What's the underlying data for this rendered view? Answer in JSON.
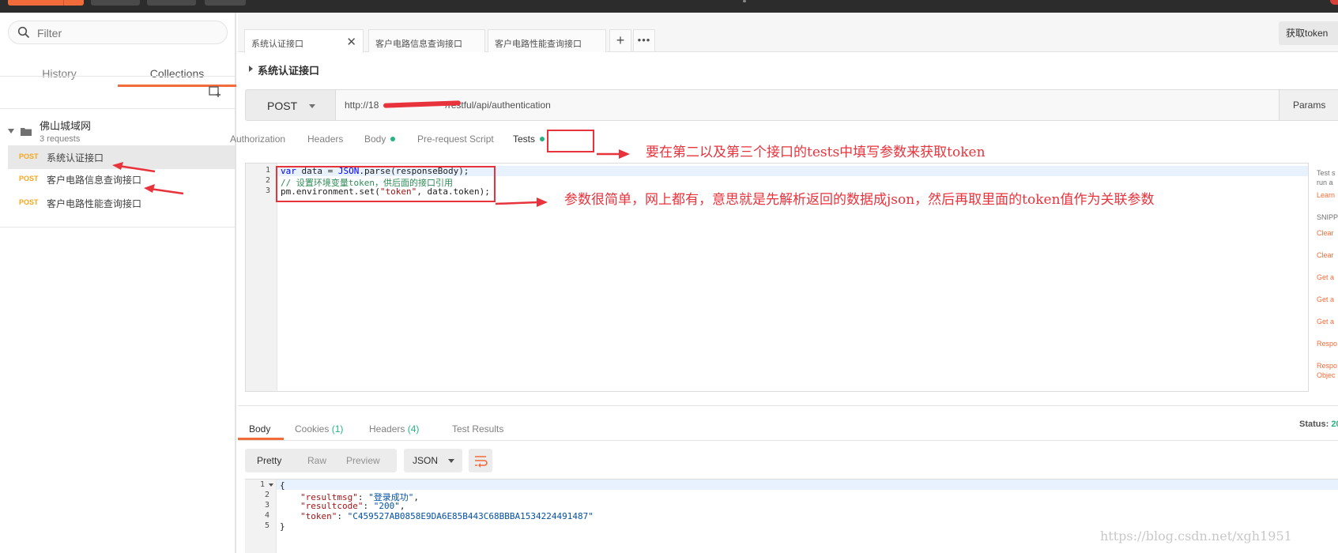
{
  "sidebar": {
    "filter_placeholder": "Filter",
    "tabs": {
      "history": "History",
      "collections": "Collections"
    },
    "collection": {
      "name": "佛山城域网",
      "count": "3 requests"
    },
    "requests": [
      {
        "method": "POST",
        "name": "系统认证接口"
      },
      {
        "method": "POST",
        "name": "客户电路信息查询接口"
      },
      {
        "method": "POST",
        "name": "客户电路性能查询接口"
      }
    ]
  },
  "tabs": {
    "items": [
      "系统认证接口",
      "客户电路信息查询接口",
      "客户电路性能查询接口"
    ],
    "add": "+",
    "more": "•••"
  },
  "get_token_label": "获取token",
  "request": {
    "title": "系统认证接口",
    "method": "POST",
    "url": "http://18",
    "url_suffix": "/restful/api/authentication",
    "params_label": "Params",
    "sub_tabs": {
      "authorization": "Authorization",
      "headers": "Headers",
      "body": "Body",
      "prerequest": "Pre-request Script",
      "tests": "Tests"
    }
  },
  "tests_code": {
    "line_numbers": [
      "1",
      "2",
      "3"
    ],
    "line1_a": "var",
    "line1_b": " data = ",
    "line1_c": "JSON",
    "line1_d": ".parse(responseBody);",
    "line2": "// 设置环境变量token，供后面的接口引用",
    "line3_a": "pm.environment.set(",
    "line3_b": "\"token\"",
    "line3_c": ", data.token);"
  },
  "snippets": {
    "intro": "Test s",
    "intro2": "run a",
    "learn": "Learn",
    "header": "SNIPP",
    "items": [
      "Clear",
      "Clear",
      "Get a",
      "Get a",
      "Get a",
      "Respo",
      "Respo",
      "Objec"
    ]
  },
  "response": {
    "tabs": {
      "body": "Body",
      "cookies": "Cookies",
      "cookies_count": "(1)",
      "headers": "Headers",
      "headers_count": "(4)",
      "test_results": "Test Results"
    },
    "status_label": "Status:",
    "status_value": "20",
    "format": {
      "pretty": "Pretty",
      "raw": "Raw",
      "preview": "Preview",
      "lang": "JSON"
    },
    "line_numbers": [
      "1",
      "2",
      "3",
      "4",
      "5"
    ],
    "json": {
      "open": "{",
      "k1": "\"resultmsg\"",
      "v1": "\"登录成功\"",
      "k2": "\"resultcode\"",
      "v2": "\"200\"",
      "k3": "\"token\"",
      "v3": "\"C459527AB0858E9DA6E85B443C68BBBA1534224491487\"",
      "close": "}"
    }
  },
  "annotations": {
    "a1": "要在第二以及第三个接口的tests中填写参数来获取token",
    "a2": "参数很简单，网上都有，意思就是先解析返回的数据成json，然后再取里面的token值作为关联参数"
  },
  "watermark": "https://blog.csdn.net/xgh1951",
  "colors": {
    "accent": "#f26b3a",
    "post": "#f7a61c",
    "green": "#26b47f",
    "annotation": "#e8323c"
  }
}
